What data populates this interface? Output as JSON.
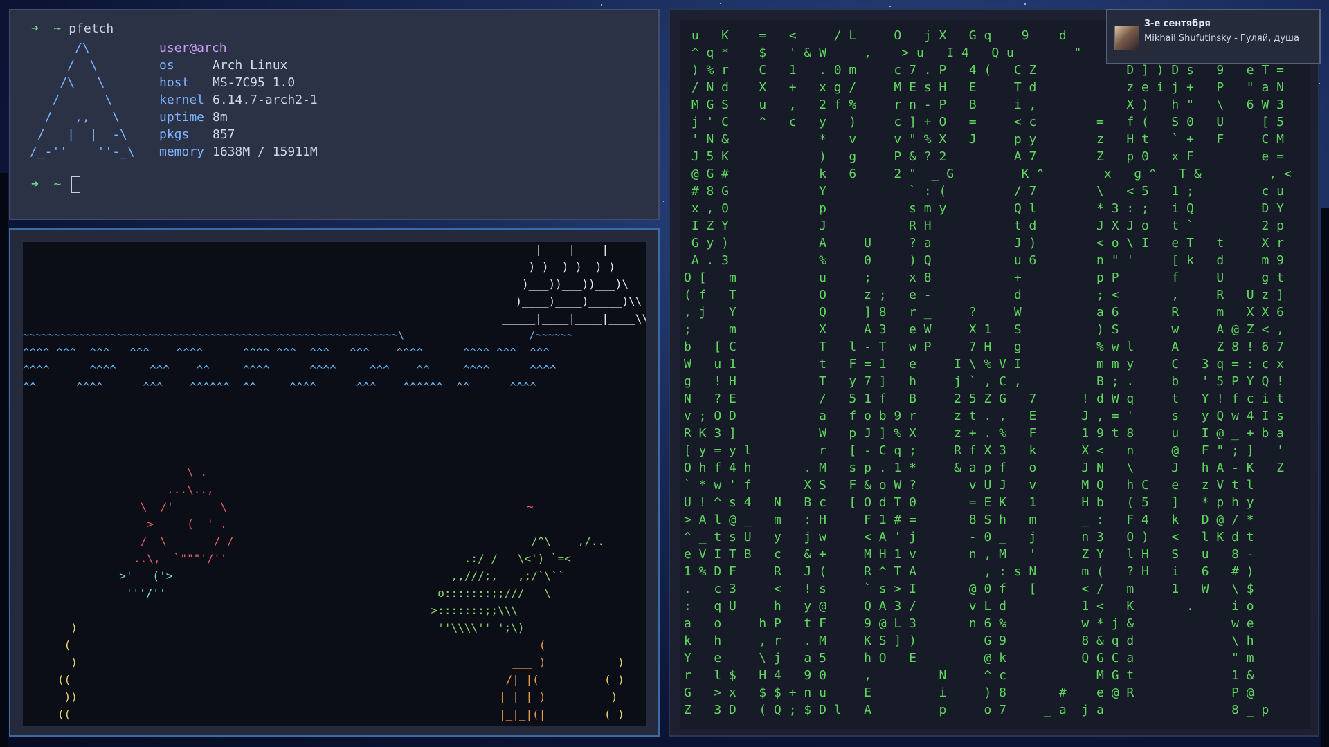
{
  "terminal_top": {
    "command_prompt": "➜  ~ ",
    "command": "pfetch",
    "logo": "      /\\\n     /  \\\n    /\\   \\\n   /      \\\n  /   ,,   \\\n /   |  |  -\\\n/_-''    ''-_\\",
    "user": "user@arch",
    "info": [
      {
        "key": "os",
        "value": "Arch Linux"
      },
      {
        "key": "host",
        "value": "MS-7C95 1.0"
      },
      {
        "key": "kernel",
        "value": "6.14.7-arch2-1"
      },
      {
        "key": "uptime",
        "value": "8m"
      },
      {
        "key": "pkgs",
        "value": "857"
      },
      {
        "key": "memory",
        "value": "1638M / 15911M"
      }
    ],
    "second_prompt": "➜  ~ "
  },
  "aquarium": {
    "ship": "             |    |    |\n            )_)  )_)  )_)\n           )___))___))___)\\\n          )____)____)_____)\\\\\n        _____|____|____|____\\\\\\__",
    "waterline": "~~~~~~~~~~~~~~~~~~~~~~~~~~~~~~~~~~~~~~~~~~~~~~~~~~~~~~~~~~~~\\                    /~~~~~~",
    "waves": "^^^^ ^^^  ^^^   ^^^    ^^^^      ^^^^ ^^^  ^^^   ^^^    ^^^^      ^^^^ ^^^  ^^^\n^^^^      ^^^^     ^^^    ^^     ^^^^      ^^^^     ^^^    ^^     ^^^^      ^^^^\n^^      ^^^^      ^^^    ^^^^^^  ^^     ^^^^      ^^^    ^^^^^^  ^^      ^^^^",
    "fish_left": "        \\ .\n     ...\\..,\n \\  /'       \\\n  >     (  ' .\n /  \\       / /\n..\\,  `\"\"\"'/''",
    "fish_small": "  >'   ('>\n   '''/''",
    "seaweed_left": "  )\n (\n  )\n((\n ))\n((",
    "bubble": "~",
    "shark": "                /^\\    ,/..\n      .:/ /   \\<') `=<\n    ,,///;,   ,;/`\\``\n  o:::::::;;///   \\\n >:::::::;;\\\\\\\n  ''\\\\\\\\'' ';\\)",
    "castle": "      (\n  ___ )\n /| |(\n| | | )\n|_|_|(|",
    "seaweed_right": "  )\n( )\n )\n( )"
  },
  "matrix_rain": " u   K    =   <     / L     O   j X   G q    9    d         \"  \n ^ q *    $   ' & W     ,    > u   I 4   Q u        \"        5  \n ) % r    C   1   . 0 m     c 7 . P   4 (   C Z            D ] ) D s   9   e T =\n / N d    X   +   x g /     M E s H   E     T d            z e i j +   P   \" a N\n M G S    u   ,   2 f %     r n - P   B     i ,            X )   h \"   \\   6 W 3\n j ' C    ^   c   y   )     c ] + O   =     < c        =   f (   S 0   U     [ 5\n ' N &            *   v     v \" % X   J     p y        z   H t   ` +   F     C M\n J 5 K            )   g     P & ? 2         A 7        Z   p 0   x F         e =\n @ G #            k   6     2 \"  _ G         K ^        x   g ^   T &         , <\n # 8 G            Y           ` : (         / 7        \\   < 5   1 ;         c u\n x , 0            p           s m y         Q l        * 3 : ;   i Q         D Y\n I Z Y            J           R H           t d        J X J o   t `         2 p\n G y )            A     U     ? a           J )        < o \\ I   e T   t     X r\n A . 3            %     0     ) Q           u 6        n \" '     [ k   d     m 9\nO [   m           u     ;     x 8           +          p P       f     U     g t\n( f   T           O     z ;   e -           d          ; <       ,     R   U z ]\n, j   Y           Q     ] 8   r _     ?     W          a 6       R     m   X X 6\n;     m           X     A 3   e W     X 1   S          ) S       w     A @ Z < ,\nb   [ C           T   l - T   w P     7 H   g          % w l     A     Z 8 ! 6 7\nW   u 1           t   F = 1   e     I \\ % V I          m m y     C   3 q = : c x\ng   ! H           T   y 7 ]   h     j ` , C ,          B ; .     b   ' 5 P Y Q !\nN   ? E           /   5 1 f   B     2 5 Z G   7      ! d W q     t   Y ! f c i t\nv ; O D           a   f o b 9 r     z t . ,   E      J , = '     s   y Q w 4 I s\nR K 3 ]           W   p J ] % X     z + . %   F      1 9 t 8     u   I @ _ + b a\n[ y = y l         r   [ - C q ;     R f X 3   k      X <   n     @   F \" ; ]   '\nO h f 4 h       . M   s p . 1 *     & a p f   o      J N   \\     J   h A - K   Z\n` * w ' f       X S   F & o W ?       v U J   v      M Q   h C   e   z V t l\nU ! ^ s 4   N   B c   [ O d T 0       = E K   1      H b   ( 5   ]   * p h y\n> A l @ _   m   : H     F 1 # =       8 S h   m      _ :   F 4   k   D @ / *\n^ _ t s U   y   j w     < A ' j       - 0 _   j      n 3   O )   <   l K d t\ne V I T B   c   & +     M H 1 v       n , M   '      Z Y   l H   S   u   8 -\n1 % D F     R   J (     R ^ T A         , : s N      m (   ? H   i   6   # )\n.   c 3     <   ! s     ` s > I       @ 0 f   [      < /   m     1   W   \\ $\n:   q U     h   y @     Q A 3 /       v L d          1 <   K       .     i o\na   o     h P   t F     9 @ L 3       n 6 %          w * j &             w e\nk   h     , r   . M     K S ] )         G 9          8 & q d             \\ h\nY   e     \\ j   a 5     h O   E         @ k          Q G C a             \" m\nr   l $   H 4   9 0     ,         N     ^ c            M G t             1 &\nG   > x   $ $ + n u     E         i     ) 8       #    e @ R             P @\nZ   3 D   ( Q ; $ D l   A         p     o 7     _ a  j a                 8 _ p",
  "notification": {
    "title": "3-е сентября",
    "body": "Mikhail Shufutinsky - Гуляй, душа",
    "icon": "album-art"
  }
}
